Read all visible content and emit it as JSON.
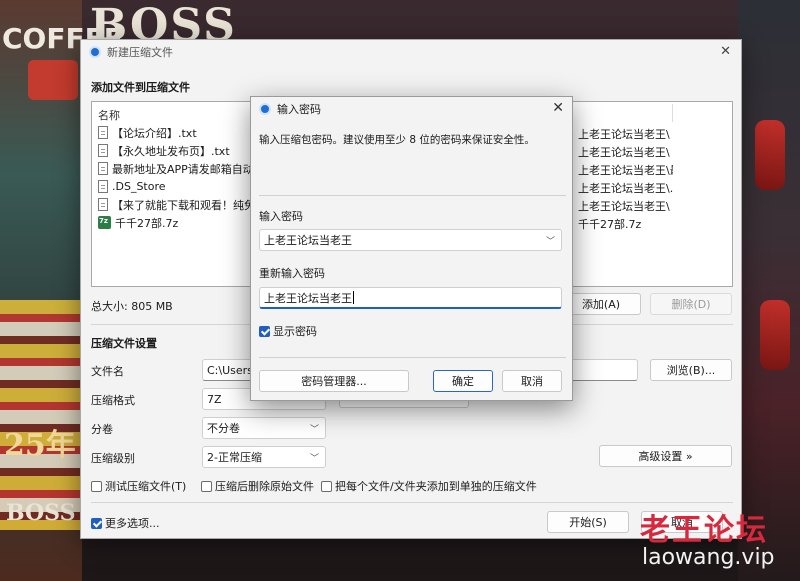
{
  "main_window": {
    "title": "新建压缩文件",
    "add_section": "添加文件到压缩文件",
    "column_name": "名称",
    "files": [
      {
        "name": "【论坛介绍】.txt",
        "type": "txt",
        "path": "上老王论坛当老王\\【论..."
      },
      {
        "name": "【永久地址发布页】.txt",
        "type": "txt",
        "path": "上老王论坛当老王\\【永..."
      },
      {
        "name": "最新地址及APP请发邮箱自动获取.txt",
        "type": "txt",
        "path": "上老王论坛当老王\\最新..."
      },
      {
        "name": ".DS_Store",
        "type": "file",
        "path": "上老王论坛当老王\\.DS_S..."
      },
      {
        "name": "【来了就能下载和观看！纯免费】.txt",
        "type": "txt",
        "path": "上老王论坛当老王\\【来..."
      },
      {
        "name": "千千27部.7z",
        "type": "7z",
        "path": "千千27部.7z"
      }
    ],
    "total_size": "总大小: 805 MB",
    "add_button": "添加(A)",
    "delete_button": "删除(D)",
    "settings_section": "压缩文件设置",
    "filename_label": "文件名",
    "filename_value": "C:\\Users\\",
    "browse_button": "浏览(B)...",
    "format_label": "压缩格式",
    "format_value": "7Z",
    "split_label": "分卷",
    "split_value": "不分卷",
    "level_label": "压缩级别",
    "level_value": "2-正常压缩",
    "advanced_button": "高级设置 »",
    "test_checkbox": "测试压缩文件(T)",
    "delete_after_checkbox": "压缩后删除原始文件",
    "separate_checkbox": "把每个文件/文件夹添加到单独的压缩文件",
    "more_options": "更多选项...",
    "start_button": "开始(S)",
    "cancel_button": "取消"
  },
  "password_dialog": {
    "title": "输入密码",
    "hint": "输入压缩包密码。建议使用至少 8 位的密码来保证安全性。",
    "enter_label": "输入密码",
    "enter_value": "上老王论坛当老王",
    "reenter_label": "重新输入密码",
    "reenter_value": "上老王论坛当老王",
    "show_password": "显示密码",
    "manager_button": "密码管理器...",
    "ok_button": "确定",
    "cancel_button": "取消"
  },
  "background": {
    "sign_top": "BOSS",
    "sign_coffee": "COFFEE",
    "sign_25": "25年",
    "sign_bottom": "BOSS"
  },
  "watermark": {
    "cn": "老王论坛",
    "url": "laowang.vip"
  },
  "colors": {
    "accent": "#1f5fbf",
    "watermark_red": "#d7283d"
  }
}
